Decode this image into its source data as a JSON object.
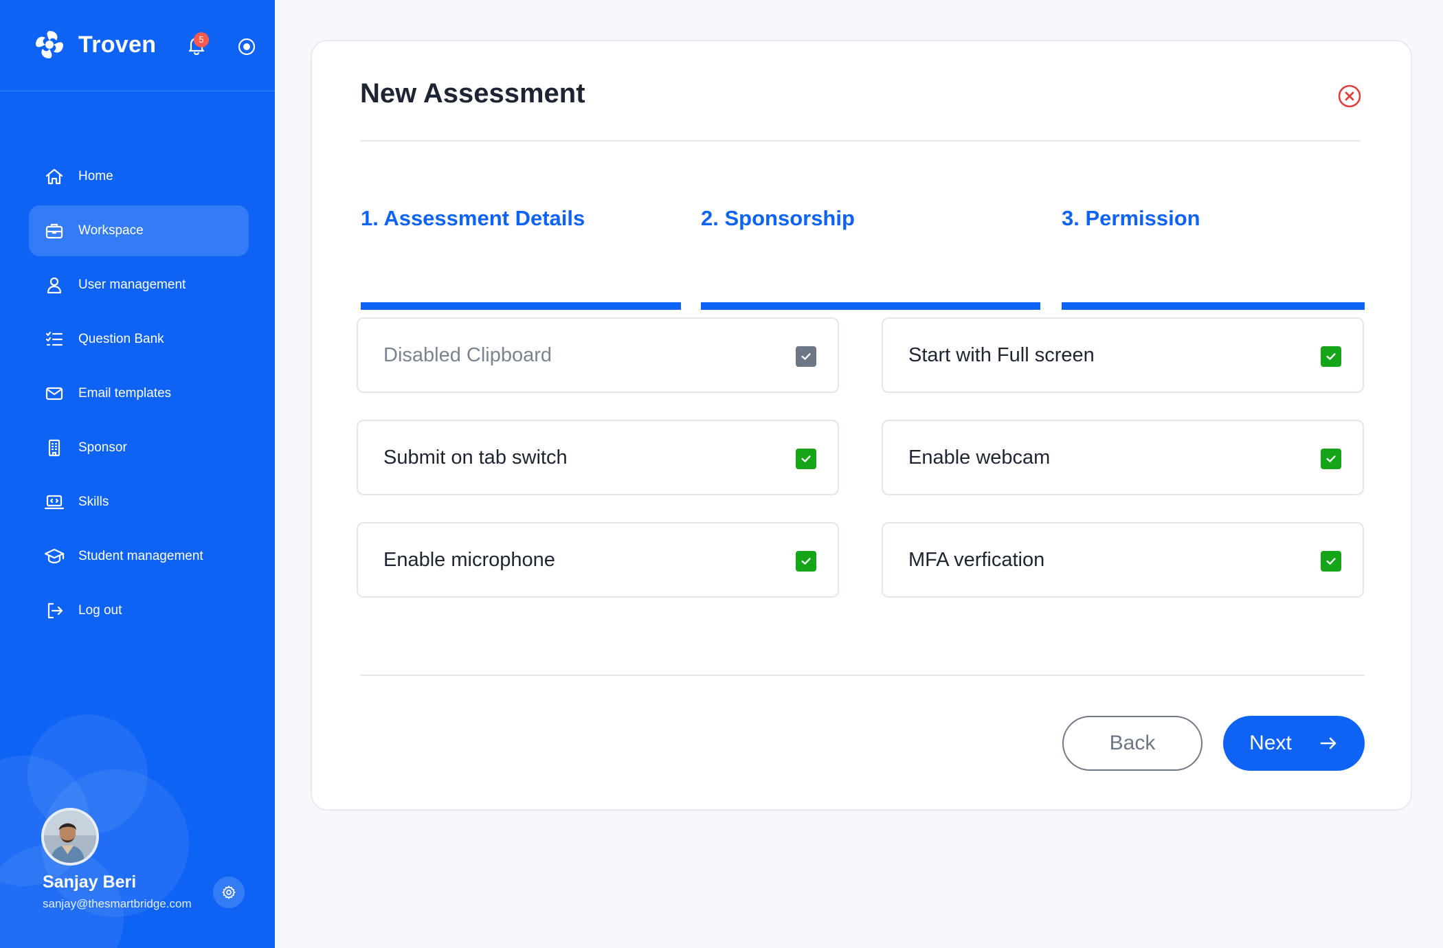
{
  "sidebar": {
    "brand": "Troven",
    "notification_count": "5",
    "nav": [
      {
        "label": "Home",
        "icon": "home-icon"
      },
      {
        "label": "Workspace",
        "icon": "briefcase-icon",
        "active": true
      },
      {
        "label": "User management",
        "icon": "user-icon"
      },
      {
        "label": "Question Bank",
        "icon": "checklist-icon"
      },
      {
        "label": "Email templates",
        "icon": "mail-icon"
      },
      {
        "label": "Sponsor",
        "icon": "building-icon"
      },
      {
        "label": "Skills",
        "icon": "laptop-code-icon"
      },
      {
        "label": "Student management",
        "icon": "graduation-cap-icon"
      },
      {
        "label": "Log out",
        "icon": "logout-icon"
      }
    ],
    "profile": {
      "name": "Sanjay Beri",
      "email": "sanjay@thesmartbridge.com"
    }
  },
  "modal": {
    "title": "New Assessment",
    "steps": [
      {
        "label": "1.  Assessment Details"
      },
      {
        "label": "2. Sponsorship"
      },
      {
        "label": "3. Permission"
      }
    ],
    "options": [
      {
        "label": "Disabled Clipboard",
        "checked": true,
        "disabled": true
      },
      {
        "label": "Start with Full screen",
        "checked": true,
        "disabled": false
      },
      {
        "label": "Submit on tab switch",
        "checked": true,
        "disabled": false
      },
      {
        "label": "Enable webcam",
        "checked": true,
        "disabled": false
      },
      {
        "label": "Enable microphone",
        "checked": true,
        "disabled": false
      },
      {
        "label": "MFA verfication",
        "checked": true,
        "disabled": false
      }
    ],
    "back_label": "Back",
    "next_label": "Next"
  },
  "colors": {
    "primary": "#0e63f5",
    "check_green": "#16a418",
    "check_disabled": "#6d7685",
    "close_red": "#e03d3d"
  }
}
